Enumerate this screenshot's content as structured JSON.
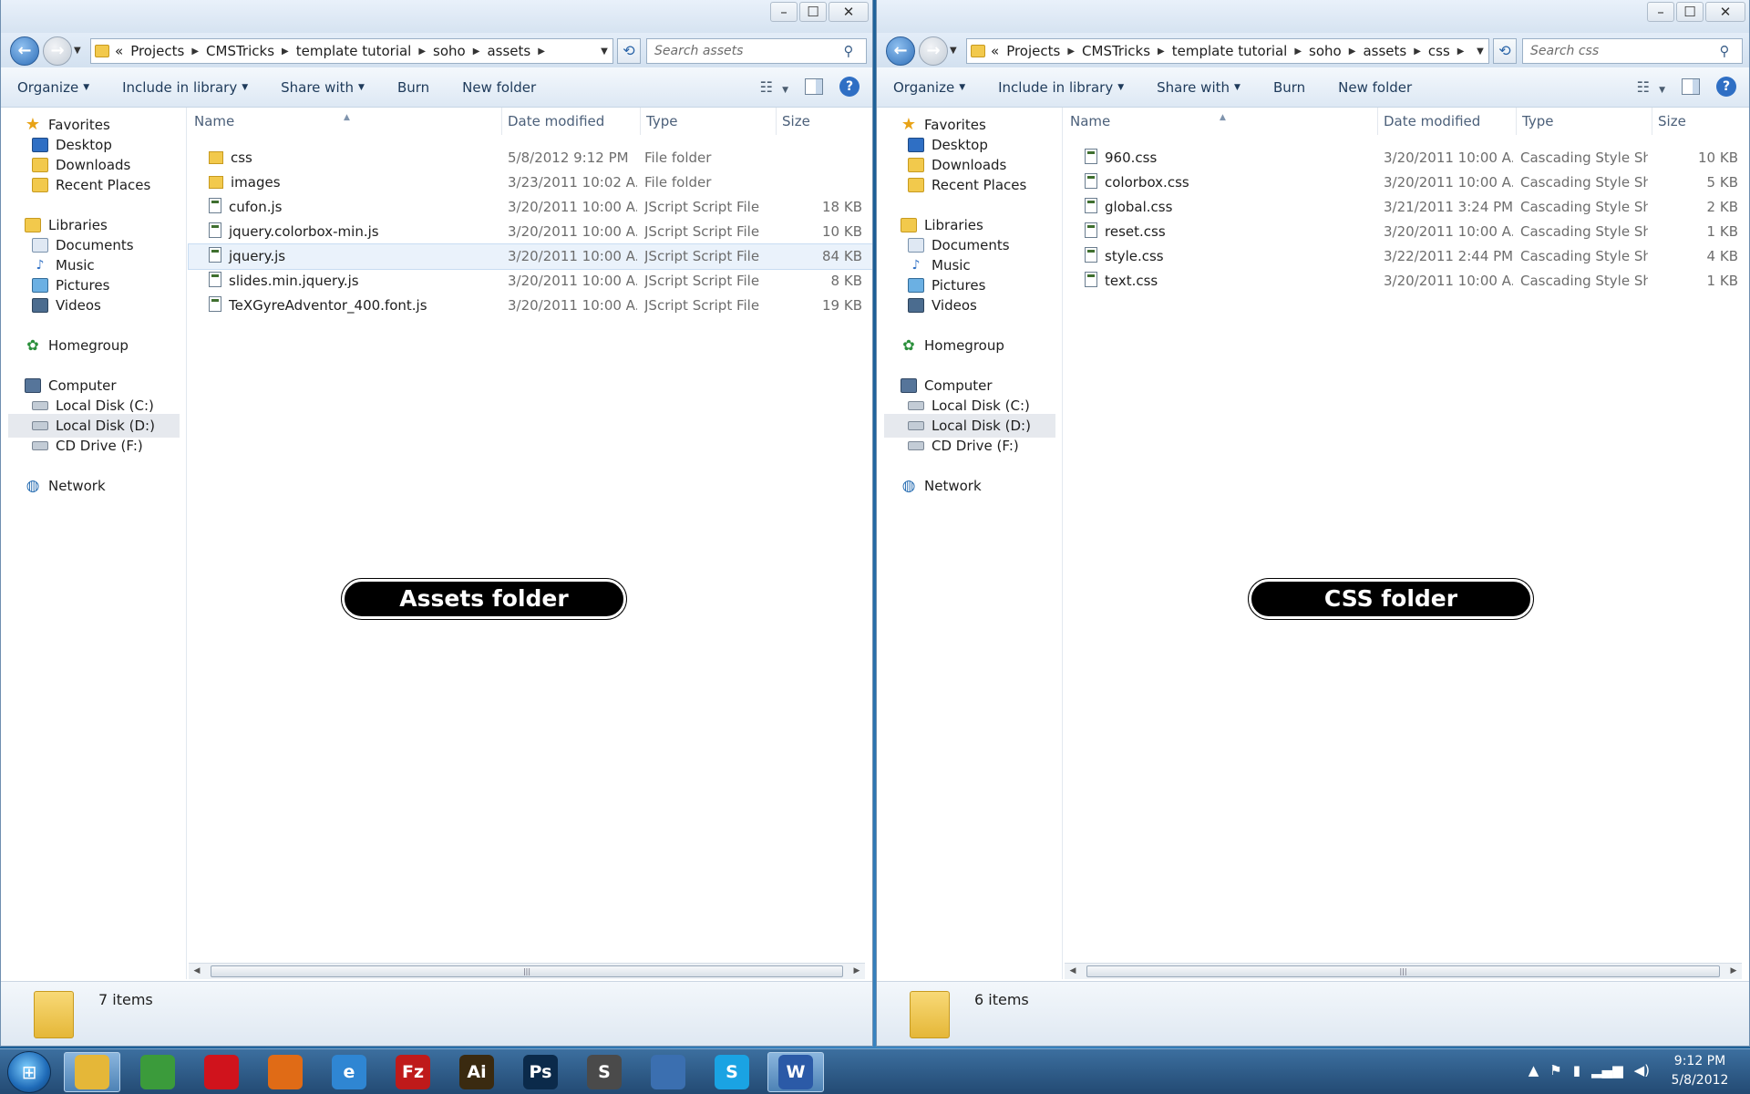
{
  "windows": {
    "left": {
      "address": {
        "overflow": "«",
        "crumbs": [
          "Projects",
          "CMSTricks",
          "template tutorial",
          "soho",
          "assets"
        ]
      },
      "search_placeholder": "Search assets",
      "toolbar": {
        "organize": "Organize",
        "include": "Include in library",
        "share": "Share with",
        "burn": "Burn",
        "new_folder": "New folder"
      },
      "columns": {
        "name": "Name",
        "date": "Date modified",
        "type": "Type",
        "size": "Size"
      },
      "files": [
        {
          "name": "css",
          "date": "5/8/2012 9:12 PM",
          "type": "File folder",
          "size": "",
          "kind": "folder"
        },
        {
          "name": "images",
          "date": "3/23/2011 10:02 A...",
          "type": "File folder",
          "size": "",
          "kind": "folder"
        },
        {
          "name": "cufon.js",
          "date": "3/20/2011 10:00 A...",
          "type": "JScript Script File",
          "size": "18 KB",
          "kind": "script"
        },
        {
          "name": "jquery.colorbox-min.js",
          "date": "3/20/2011 10:00 A...",
          "type": "JScript Script File",
          "size": "10 KB",
          "kind": "script"
        },
        {
          "name": "jquery.js",
          "date": "3/20/2011 10:00 A...",
          "type": "JScript Script File",
          "size": "84 KB",
          "kind": "script"
        },
        {
          "name": "slides.min.jquery.js",
          "date": "3/20/2011 10:00 A...",
          "type": "JScript Script File",
          "size": "8 KB",
          "kind": "script"
        },
        {
          "name": "TeXGyreAdventor_400.font.js",
          "date": "3/20/2011 10:00 A...",
          "type": "JScript Script File",
          "size": "19 KB",
          "kind": "script"
        }
      ],
      "selected_file": 4,
      "label": "Assets folder",
      "status": "7 items"
    },
    "right": {
      "address": {
        "overflow": "«",
        "crumbs": [
          "Projects",
          "CMSTricks",
          "template tutorial",
          "soho",
          "assets",
          "css"
        ]
      },
      "search_placeholder": "Search css",
      "toolbar": {
        "organize": "Organize",
        "include": "Include in library",
        "share": "Share with",
        "burn": "Burn",
        "new_folder": "New folder"
      },
      "columns": {
        "name": "Name",
        "date": "Date modified",
        "type": "Type",
        "size": "Size"
      },
      "files": [
        {
          "name": "960.css",
          "date": "3/20/2011 10:00 A...",
          "type": "Cascading Style Sh...",
          "size": "10 KB",
          "kind": "style"
        },
        {
          "name": "colorbox.css",
          "date": "3/20/2011 10:00 A...",
          "type": "Cascading Style Sh...",
          "size": "5 KB",
          "kind": "style"
        },
        {
          "name": "global.css",
          "date": "3/21/2011 3:24 PM",
          "type": "Cascading Style Sh...",
          "size": "2 KB",
          "kind": "style"
        },
        {
          "name": "reset.css",
          "date": "3/20/2011 10:00 A...",
          "type": "Cascading Style Sh...",
          "size": "1 KB",
          "kind": "style"
        },
        {
          "name": "style.css",
          "date": "3/22/2011 2:44 PM",
          "type": "Cascading Style Sh...",
          "size": "4 KB",
          "kind": "style"
        },
        {
          "name": "text.css",
          "date": "3/20/2011 10:00 A...",
          "type": "Cascading Style Sh...",
          "size": "1 KB",
          "kind": "style"
        }
      ],
      "selected_file": -1,
      "label": "CSS folder",
      "status": "6 items"
    }
  },
  "nav_pane": [
    {
      "label": "Favorites",
      "icon": "star-icon",
      "level": 0
    },
    {
      "label": "Desktop",
      "icon": "desktop-icon",
      "level": 1
    },
    {
      "label": "Downloads",
      "icon": "downloads-folder-icon",
      "level": 1
    },
    {
      "label": "Recent Places",
      "icon": "recent-places-icon",
      "level": 1
    },
    {
      "label": "Libraries",
      "icon": "libraries-icon",
      "level": 0
    },
    {
      "label": "Documents",
      "icon": "documents-icon",
      "level": 1
    },
    {
      "label": "Music",
      "icon": "music-icon",
      "level": 1
    },
    {
      "label": "Pictures",
      "icon": "pictures-icon",
      "level": 1
    },
    {
      "label": "Videos",
      "icon": "videos-icon",
      "level": 1
    },
    {
      "label": "Homegroup",
      "icon": "homegroup-icon",
      "level": 0
    },
    {
      "label": "Computer",
      "icon": "computer-icon",
      "level": 0
    },
    {
      "label": "Local Disk (C:)",
      "icon": "disk-icon",
      "level": 1
    },
    {
      "label": "Local Disk (D:)",
      "icon": "disk-icon",
      "level": 1,
      "selected": true
    },
    {
      "label": "CD Drive (F:)",
      "icon": "cd-drive-icon",
      "level": 1
    },
    {
      "label": "Network",
      "icon": "network-icon",
      "level": 0
    }
  ],
  "taskbar": {
    "apps": [
      {
        "name": "windows-explorer",
        "icon": "explorer-icon",
        "glyph": "",
        "color": "#e5b738",
        "active": true
      },
      {
        "name": "chrome",
        "icon": "chrome-icon",
        "glyph": "",
        "color": "#3b9b3b"
      },
      {
        "name": "opera",
        "icon": "opera-icon",
        "glyph": "",
        "color": "#d0131c"
      },
      {
        "name": "firefox",
        "icon": "firefox-icon",
        "glyph": "",
        "color": "#e06b16"
      },
      {
        "name": "internet-explorer",
        "icon": "ie-icon",
        "glyph": "e",
        "color": "#2f86d3"
      },
      {
        "name": "filezilla",
        "icon": "filezilla-icon",
        "glyph": "Fz",
        "color": "#bf1a1a"
      },
      {
        "name": "illustrator",
        "icon": "illustrator-icon",
        "glyph": "Ai",
        "color": "#3a2a10"
      },
      {
        "name": "photoshop",
        "icon": "photoshop-icon",
        "glyph": "Ps",
        "color": "#0b2a4a"
      },
      {
        "name": "sublime",
        "icon": "sublime-icon",
        "glyph": "S",
        "color": "#4a4a4a"
      },
      {
        "name": "thunderbird",
        "icon": "thunderbird-icon",
        "glyph": "",
        "color": "#3b6fb0"
      },
      {
        "name": "skype",
        "icon": "skype-icon",
        "glyph": "S",
        "color": "#1aa3e3"
      },
      {
        "name": "word",
        "icon": "word-icon",
        "glyph": "W",
        "color": "#2b5aa7",
        "active": true
      }
    ],
    "tray_icons": [
      "flag-icon",
      "removable-device-icon",
      "network-signal-icon",
      "volume-icon"
    ],
    "clock": {
      "time": "9:12 PM",
      "date": "5/8/2012"
    }
  }
}
